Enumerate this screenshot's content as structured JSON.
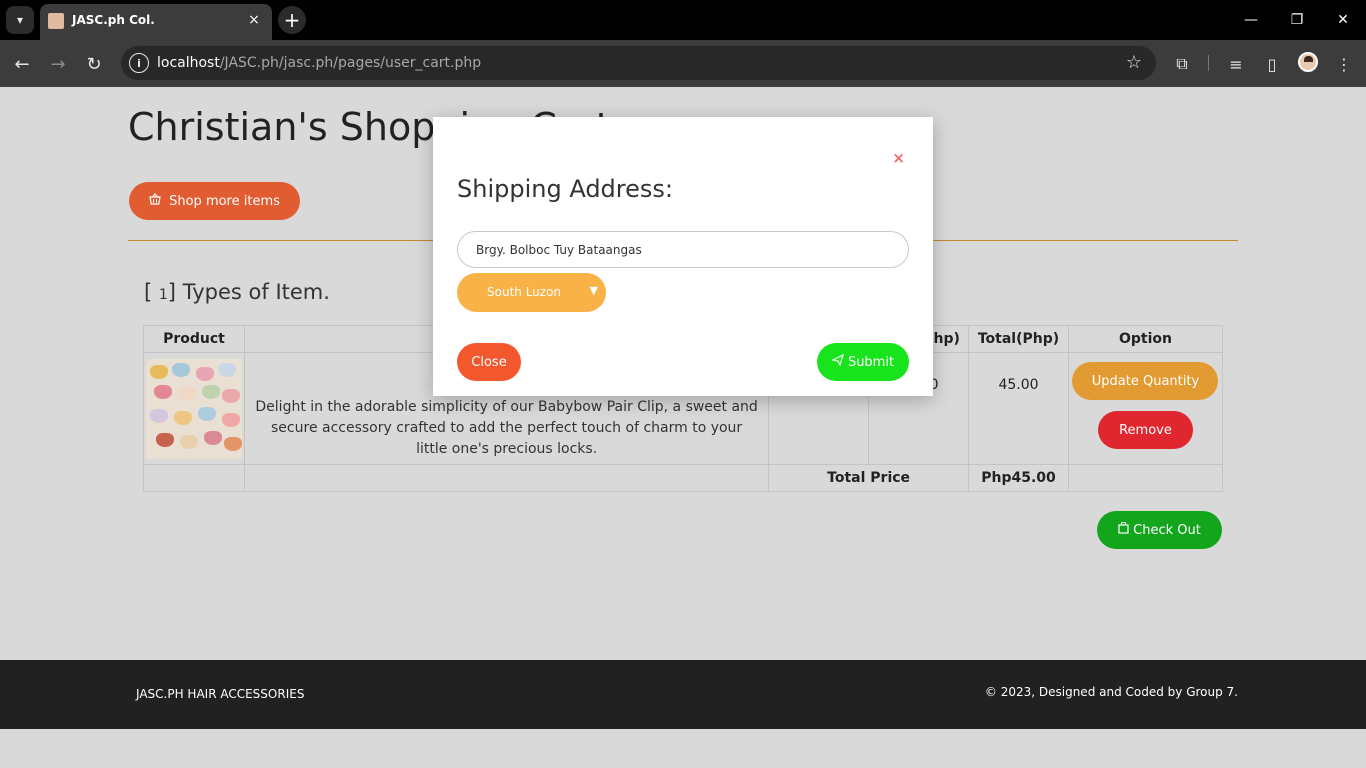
{
  "browser": {
    "tab_title": "JASC.ph Col.",
    "tab_close": "×",
    "new_tab": "+",
    "url_host": "localhost",
    "url_path": "/JASC.ph/jasc.ph/pages/user_cart.php",
    "icons": [
      "tab-search-icon",
      "back-arrow-icon",
      "forward-arrow-icon",
      "reload-icon",
      "site-info-icon",
      "bookmark-star-icon",
      "extensions-icon",
      "media-control-icon",
      "side-panel-icon",
      "profile-avatar-icon",
      "menu-kebab-icon",
      "minimize-icon",
      "restore-icon",
      "close-window-icon"
    ]
  },
  "page": {
    "title": "Christian's Shopping Cart",
    "shop_more_label": "Shop more items",
    "types_count": "1",
    "types_label": "Types of Item.",
    "table": {
      "headers": [
        "Product",
        "",
        "",
        "Price(Php)",
        "Total(Php)",
        "Option"
      ],
      "row": {
        "description": "Delight in the adorable simplicity of our Babybow Pair Clip, a sweet and secure accessory crafted to add the perfect touch of charm to your little one's precious locks.",
        "price": "45.00",
        "total": "45.00",
        "update_label": "Update Quantity",
        "remove_label": "Remove"
      },
      "total_label": "Total Price",
      "total_value": "Php45.00"
    },
    "checkout_label": "Check Out"
  },
  "footer": {
    "brand": "JASC.PH HAIR ACCESSORIES",
    "copyright": "© 2023, Designed and Coded by Group 7."
  },
  "modal": {
    "close_x": "×",
    "title": "Shipping Address:",
    "address_value": "Brgy. Bolboc Tuy Bataangas",
    "region_selected": "South Luzon",
    "close_label": "Close",
    "submit_label": "Submit"
  },
  "colors": {
    "accent_orange": "#e15c30",
    "update_orange": "#e19b32",
    "remove_red": "#e0262e",
    "checkout_green": "#13a51c",
    "submit_green": "#18e41b",
    "select_amber": "#f9b246"
  }
}
